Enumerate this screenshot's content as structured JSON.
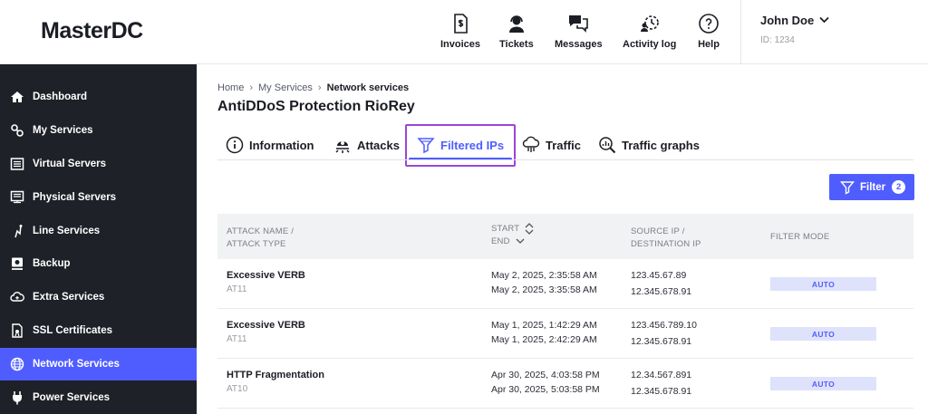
{
  "header": {
    "logo": "MasterDC",
    "nav": [
      {
        "label": "Invoices",
        "icon": "invoice-icon"
      },
      {
        "label": "Tickets",
        "icon": "support-agent-icon"
      },
      {
        "label": "Messages",
        "icon": "chat-bubbles-icon"
      },
      {
        "label": "Activity log",
        "icon": "activity-log-icon"
      },
      {
        "label": "Help",
        "icon": "help-icon"
      }
    ],
    "user": {
      "name": "John Doe",
      "id": "ID: 1234"
    }
  },
  "sidebar": {
    "items": [
      {
        "label": "Dashboard",
        "icon": "home-icon"
      },
      {
        "label": "My Services",
        "icon": "services-icon"
      },
      {
        "label": "Virtual Servers",
        "icon": "virtual-server-icon"
      },
      {
        "label": "Physical Servers",
        "icon": "physical-server-icon"
      },
      {
        "label": "Line Services",
        "icon": "line-icon"
      },
      {
        "label": "Backup",
        "icon": "backup-icon"
      },
      {
        "label": "Extra Services",
        "icon": "cloud-plus-icon"
      },
      {
        "label": "SSL Certificates",
        "icon": "certificate-icon"
      },
      {
        "label": "Network Services",
        "icon": "globe-icon",
        "active": true
      },
      {
        "label": "Power Services",
        "icon": "plug-icon"
      }
    ]
  },
  "breadcrumb": {
    "items": [
      "Home",
      "My Services",
      "Network services"
    ]
  },
  "page": {
    "title": "AntiDDoS Protection RioRey"
  },
  "tabs": [
    {
      "label": "Information",
      "icon": "info-icon"
    },
    {
      "label": "Attacks",
      "icon": "attack-icon"
    },
    {
      "label": "Filtered IPs",
      "icon": "funnel-icon",
      "active": true
    },
    {
      "label": "Traffic",
      "icon": "cloud-traffic-icon"
    },
    {
      "label": "Traffic graphs",
      "icon": "graph-search-icon"
    }
  ],
  "filter": {
    "label": "Filter",
    "count": "2"
  },
  "table": {
    "headers": {
      "attack_line1": "ATTACK NAME /",
      "attack_line2": "ATTACK TYPE",
      "start": "START",
      "end": "END",
      "ip_line1": "SOURCE IP /",
      "ip_line2": "DESTINATION IP",
      "mode": "FILTER MODE"
    },
    "rows": [
      {
        "name": "Excessive VERB",
        "type": "AT11",
        "start": "May 2, 2025, 2:35:58 AM",
        "end": "May 2, 2025, 3:35:58 AM",
        "source_ip": "123.45.67.89",
        "dest_ip": "12.345.678.91",
        "mode": "AUTO"
      },
      {
        "name": "Excessive VERB",
        "type": "AT11",
        "start": "May 1, 2025, 1:42:29 AM",
        "end": "May 1, 2025, 2:42:29 AM",
        "source_ip": "123.456.789.10",
        "dest_ip": "12.345.678.91",
        "mode": "AUTO"
      },
      {
        "name": "HTTP Fragmentation",
        "type": "AT10",
        "start": "Apr 30, 2025, 4:03:58 PM",
        "end": "Apr 30, 2025, 5:03:58 PM",
        "source_ip": "12.34.567.891",
        "dest_ip": "12.345.678.91",
        "mode": "AUTO"
      }
    ]
  },
  "colors": {
    "accent": "#4f5dff",
    "sidebar_bg": "#1f2128",
    "highlight_border": "#9a46d6"
  }
}
